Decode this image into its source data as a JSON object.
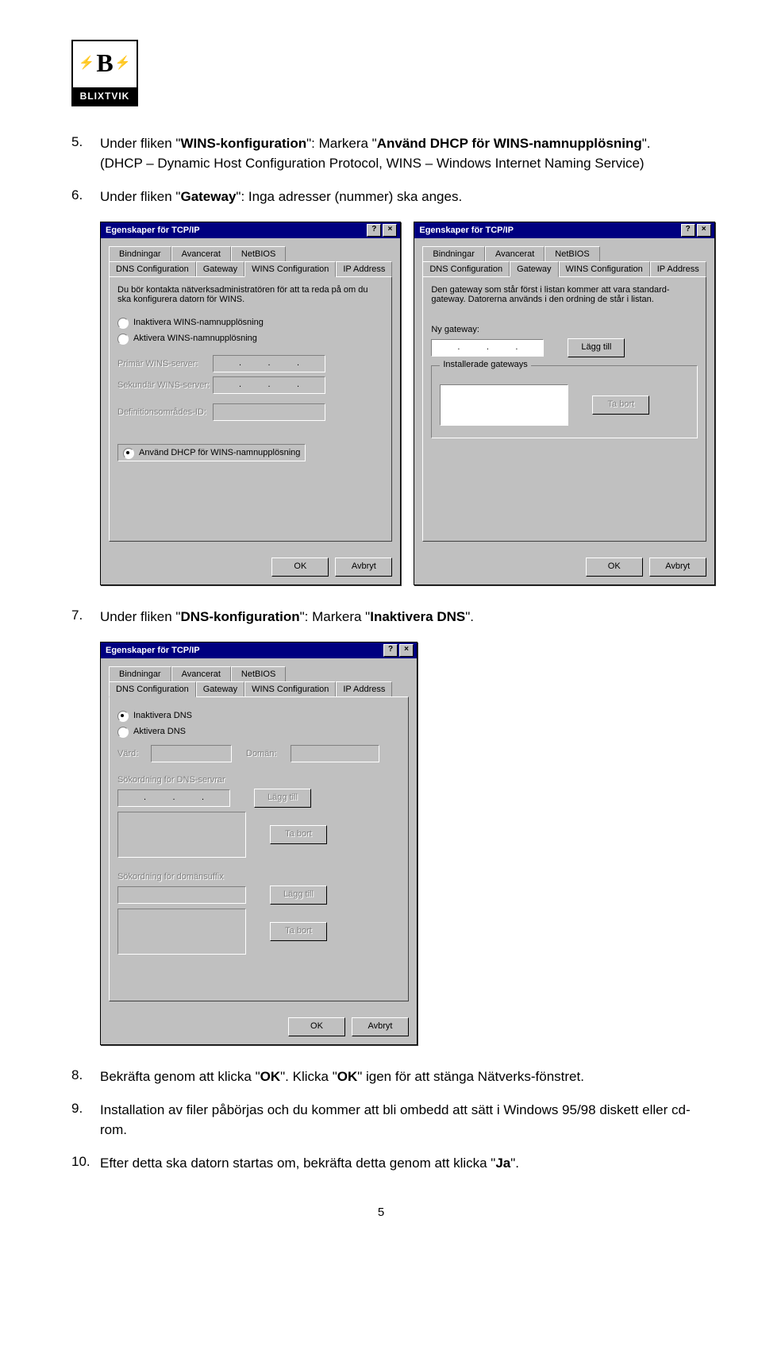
{
  "logo": {
    "brand": "BLIXTVIK"
  },
  "steps": {
    "s5": {
      "num": "5.",
      "pre": "Under fliken \"",
      "b1": "WINS-konfiguration",
      "mid": "\": Markera \"",
      "b2": "Använd DHCP för WINS-namnupplösning",
      "post": "\". (DHCP – Dynamic Host Configuration Protocol, WINS – Windows Internet Naming Service)"
    },
    "s6": {
      "num": "6.",
      "pre": "Under fliken \"",
      "b1": "Gateway",
      "post": "\": Inga adresser (nummer) ska anges."
    },
    "s7": {
      "num": "7.",
      "pre": "Under fliken \"",
      "b1": "DNS-konfiguration",
      "mid": "\": Markera \"",
      "b2": "Inaktivera DNS",
      "post": "\"."
    },
    "s8": {
      "num": "8.",
      "pre": "Bekräfta genom att klicka \"",
      "b1": "OK",
      "mid": "\". Klicka \"",
      "b2": "OK",
      "post": "\" igen för att stänga Nätverks-fönstret."
    },
    "s9": {
      "num": "9.",
      "txt": "Installation av filer påbörjas och du kommer att bli ombedd att sätt i Windows 95/98 diskett eller cd-rom."
    },
    "s10": {
      "num": "10.",
      "pre": "Efter detta ska datorn startas om, bekräfta detta genom att klicka \"",
      "b1": "Ja",
      "post": "\"."
    }
  },
  "dlg": {
    "title": "Egenskaper för TCP/IP",
    "help": "?",
    "close": "×",
    "tabs": {
      "bind": "Bindningar",
      "adv": "Avancerat",
      "netbios": "NetBIOS",
      "dns": "DNS Configuration",
      "gw": "Gateway",
      "wins": "WINS Configuration",
      "ip": "IP Address"
    },
    "ok": "OK",
    "cancel": "Avbryt"
  },
  "wins": {
    "intro": "Du bör kontakta nätverksadministratören för att ta reda på om du ska konfigurera datorn för WINS.",
    "r_dis": "Inaktivera WINS-namnupplösning",
    "r_en": "Aktivera WINS-namnupplösning",
    "primary": "Primär WINS-server:",
    "secondary": "Sekundär WINS-server:",
    "defid": "Definitionsområdes-ID:",
    "r_dhcp": "Använd DHCP för WINS-namnupplösning"
  },
  "gw": {
    "intro": "Den gateway som står först i listan kommer att vara standard-gateway. Datorerna används i den ordning de står i listan.",
    "new": "Ny gateway:",
    "add": "Lägg till",
    "installed": "Installerade gateways",
    "remove": "Ta bort"
  },
  "dns": {
    "r_dis": "Inaktivera DNS",
    "r_en": "Aktivera DNS",
    "host": "Värd:",
    "domain": "Domän:",
    "srv_order": "Sökordning för DNS-servrar",
    "add": "Lägg till",
    "remove": "Ta bort",
    "suf_order": "Sökordning för domänsuffix"
  },
  "page_num": "5"
}
